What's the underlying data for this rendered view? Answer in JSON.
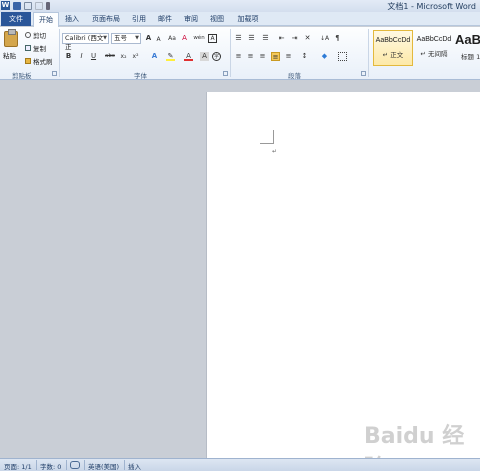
{
  "window": {
    "app_logo": "W",
    "title": "文档1 - Microsoft Word"
  },
  "tabs": {
    "file": "文件",
    "items": [
      "开始",
      "插入",
      "页面布局",
      "引用",
      "邮件",
      "审阅",
      "视图",
      "加载项"
    ],
    "active_index": 0
  },
  "clipboard": {
    "paste": "粘贴",
    "cut": "剪切",
    "copy": "复制",
    "format_painter": "格式刷",
    "group_label": "剪贴板"
  },
  "font": {
    "font_name": "Calibri (西文正",
    "font_size": "五号",
    "group_label": "字体",
    "bold": "B",
    "italic": "I",
    "underline": "U",
    "strike": "abc",
    "subscript": "x₂",
    "superscript": "x²",
    "grow": "A",
    "shrink": "A",
    "aa": "Aa",
    "clear": "A",
    "phonetic": "wén",
    "font_color": "A"
  },
  "paragraph": {
    "group_label": "段落"
  },
  "styles": {
    "items": [
      {
        "sample": "AaBbCcDd",
        "name": "↵ 正文"
      },
      {
        "sample": "AaBbCcDd",
        "name": "↵ 无间隔"
      },
      {
        "sample": "AaB",
        "name": "标题 1"
      }
    ]
  },
  "statusbar": {
    "page": "页面: 1/1",
    "words": "字数: 0",
    "language": "英语(美国)",
    "mode": "插入"
  },
  "watermark": "Baidu 经验",
  "colors": {
    "file_tab": "#2a5699",
    "highlight": "#ffef3b",
    "font_color_bar": "#e03030"
  }
}
